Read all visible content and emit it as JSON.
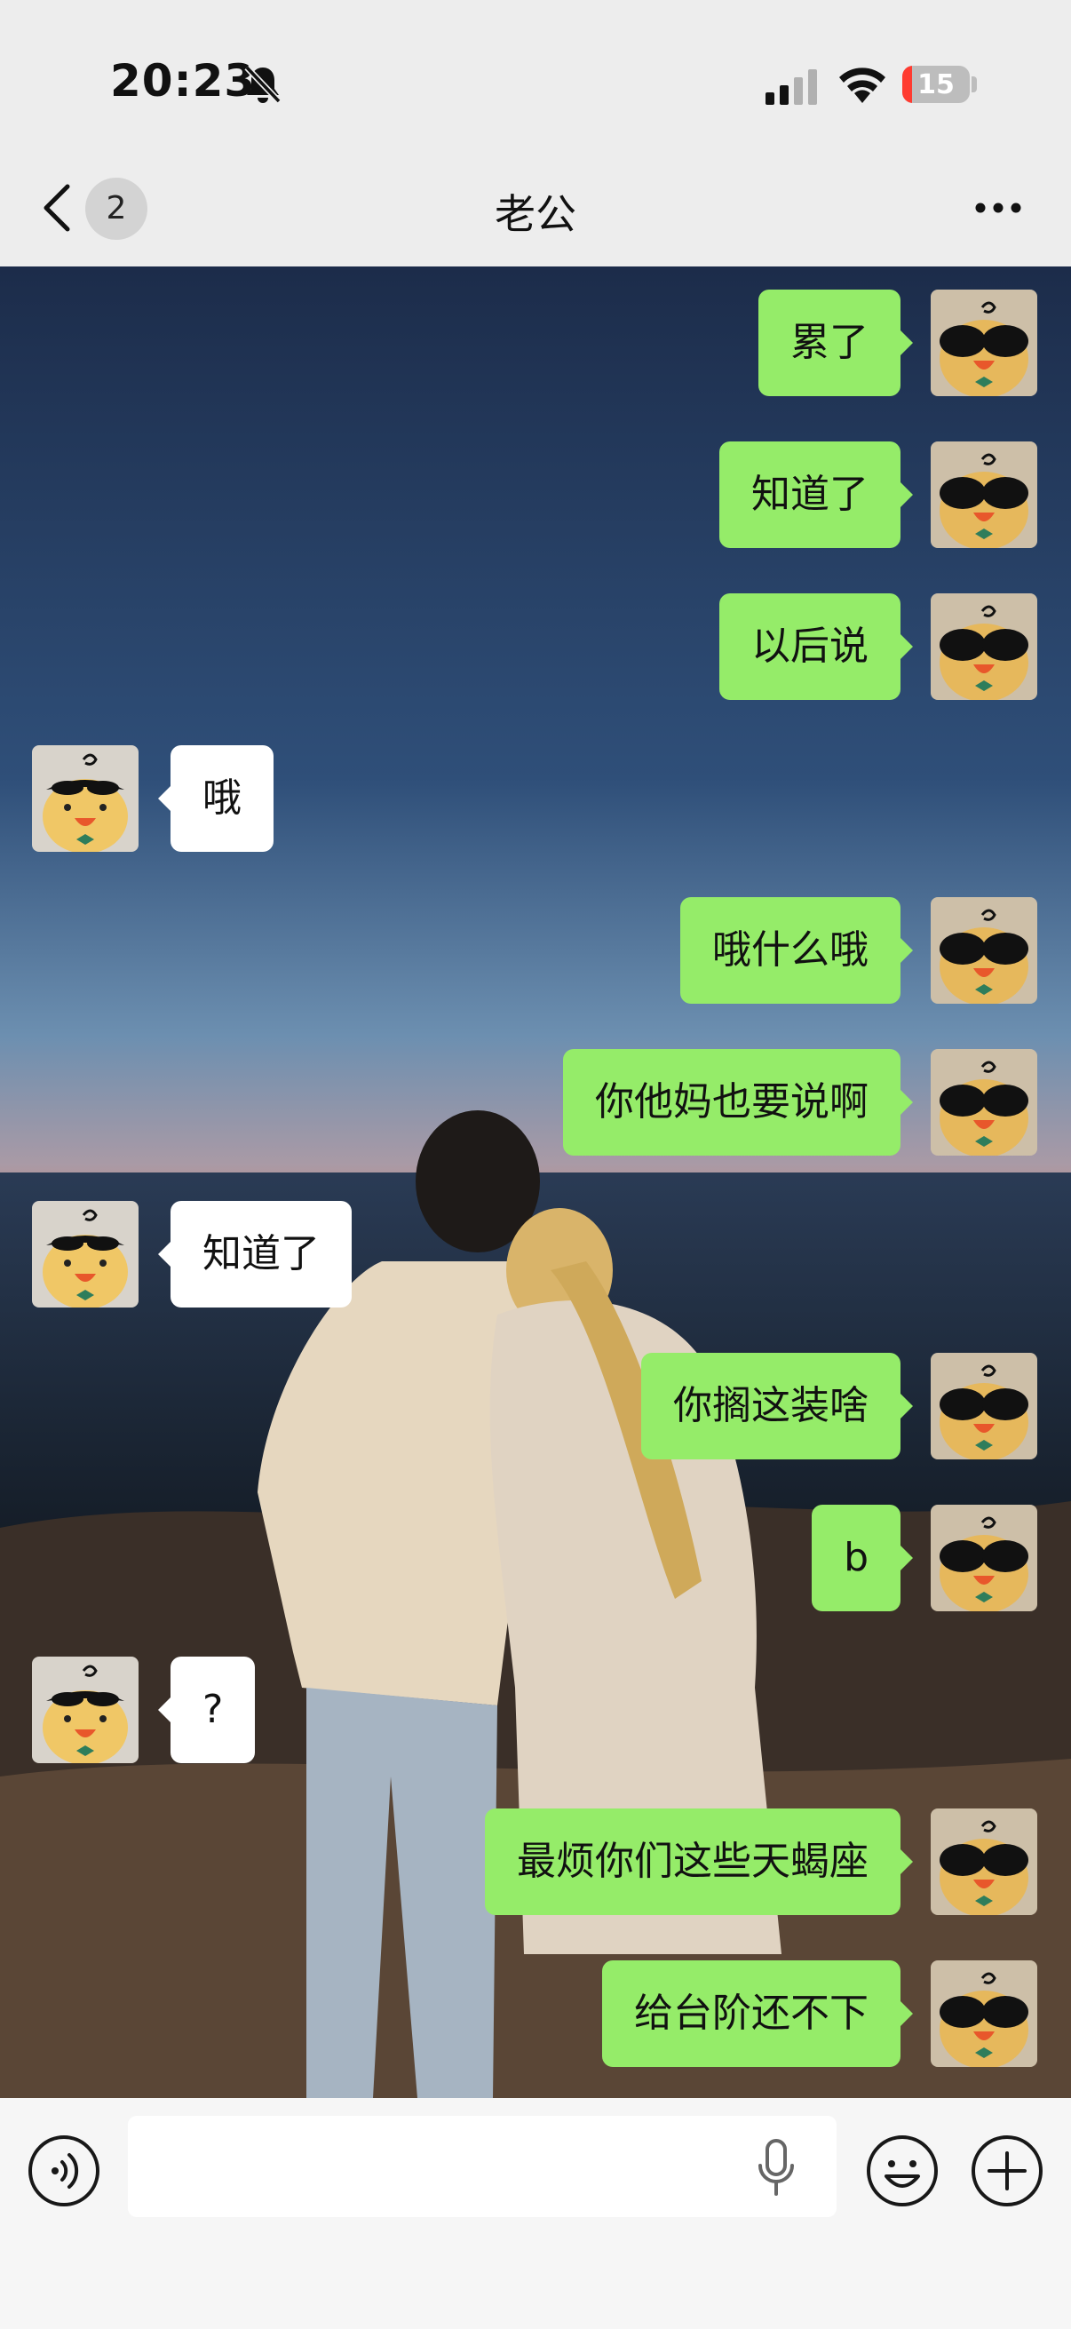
{
  "status_bar": {
    "time": "20:23",
    "battery": "15",
    "battery_level": 0.15,
    "battery_color": "#ff3b30"
  },
  "nav": {
    "unread_count": "2",
    "title": "老公"
  },
  "colors": {
    "sent_bubble": "#95ec69",
    "received_bubble": "#ffffff"
  },
  "icons": {
    "status": [
      "bell-slash-icon",
      "cellular-signal-icon",
      "wifi-icon",
      "battery-icon"
    ],
    "nav": [
      "chevron-left-icon",
      "more-horizontal-icon"
    ],
    "input": [
      "voice-icon",
      "microphone-icon",
      "emoji-icon",
      "plus-icon"
    ]
  },
  "messages": [
    {
      "side": "me",
      "text": "累了"
    },
    {
      "side": "me",
      "text": "知道了"
    },
    {
      "side": "me",
      "text": "以后说"
    },
    {
      "side": "them",
      "text": "哦"
    },
    {
      "side": "me",
      "text": "哦什么哦"
    },
    {
      "side": "me",
      "text": "你他妈也要说啊"
    },
    {
      "side": "them",
      "text": "知道了"
    },
    {
      "side": "me",
      "text": "你搁这装啥"
    },
    {
      "side": "me",
      "text": "b"
    },
    {
      "side": "them",
      "text": "?"
    },
    {
      "side": "me",
      "text": "最烦你们这些天蝎座"
    },
    {
      "side": "me",
      "text": "给台阶还不下"
    }
  ],
  "input": {
    "value": ""
  }
}
